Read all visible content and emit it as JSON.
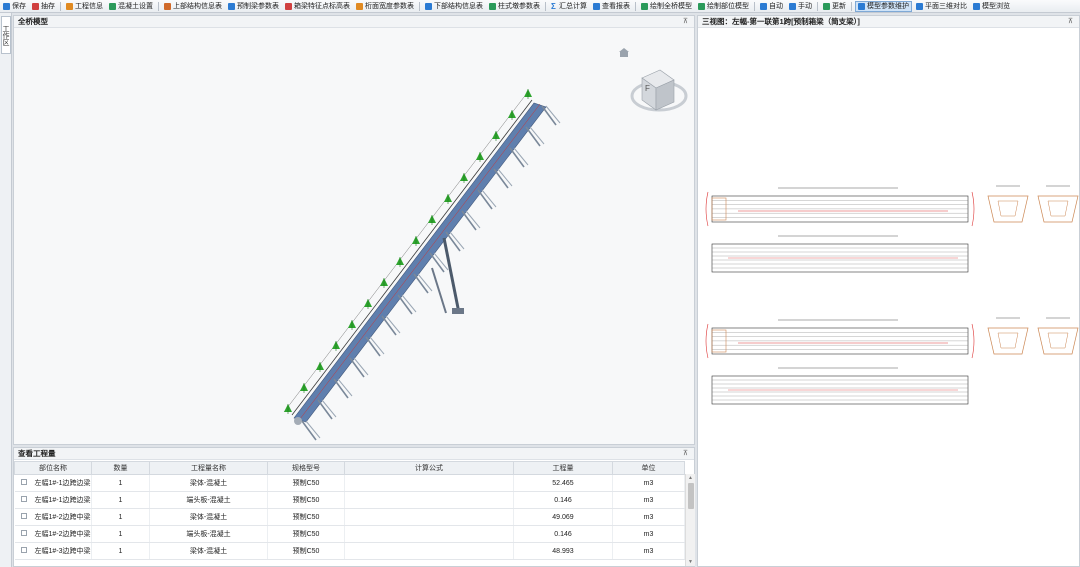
{
  "toolbar": {
    "items": [
      {
        "label": "保存",
        "color": "#2b7bd3"
      },
      {
        "label": "抽存",
        "color": "#d04040"
      },
      {
        "label": "工程信息",
        "color": "#e08a22"
      },
      {
        "label": "混凝土设置",
        "color": "#2a9a5a"
      },
      {
        "label": "上部结构信息表",
        "color": "#d06a2a"
      },
      {
        "label": "预制梁参数表",
        "color": "#2b7bd3"
      },
      {
        "label": "箱梁特征点标高表",
        "color": "#d04040"
      },
      {
        "label": "桁面宽度参数表",
        "color": "#e08a22"
      },
      {
        "label": "下部结构信息表",
        "color": "#2b7bd3"
      },
      {
        "label": "柱式墩参数表",
        "color": "#2a9a5a"
      },
      {
        "label": "汇总计算",
        "glyph": "Σ",
        "color": "#2b7bd3"
      },
      {
        "label": "查看报表",
        "color": "#2b7bd3"
      },
      {
        "label": "绘制全桥模型",
        "color": "#2a9a5a"
      },
      {
        "label": "绘制部位模型",
        "color": "#2a9a5a"
      },
      {
        "label": "自动",
        "color": "#2b7bd3"
      },
      {
        "label": "手动",
        "color": "#2b7bd3"
      },
      {
        "label": "更新",
        "color": "#2a9a5a"
      },
      {
        "label": "模型参数维护",
        "color": "#2b7bd3",
        "active": true
      },
      {
        "label": "平面三维对比",
        "color": "#2b7bd3"
      },
      {
        "label": "模型浏览",
        "color": "#2b7bd3"
      }
    ]
  },
  "left_tab": {
    "label": "工作区"
  },
  "model_panel": {
    "title": "全桥模型",
    "pin": "⊼",
    "viewcube_face": "F"
  },
  "drawing_panel": {
    "title": "三视图：左幅-第一联第1跨[预制箱梁（简支梁）]",
    "pin": "⊼"
  },
  "quantity_panel": {
    "title": "查看工程量",
    "pin": "⊼",
    "columns": [
      "部位名称",
      "数量",
      "工程量名称",
      "规格型号",
      "计算公式",
      "工程量",
      "单位"
    ],
    "rows": [
      [
        "左幅1#-1边跨边梁",
        "1",
        "梁体-混凝土",
        "预制C50",
        "",
        "52.465",
        "m3"
      ],
      [
        "左幅1#-1边跨边梁",
        "1",
        "端头板-混凝土",
        "预制C50",
        "",
        "0.146",
        "m3"
      ],
      [
        "左幅1#-2边跨中梁",
        "1",
        "梁体-混凝土",
        "预制C50",
        "",
        "49.069",
        "m3"
      ],
      [
        "左幅1#-2边跨中梁",
        "1",
        "端头板-混凝土",
        "预制C50",
        "",
        "0.146",
        "m3"
      ],
      [
        "左幅1#-3边跨中梁",
        "1",
        "梁体-混凝土",
        "预制C50",
        "",
        "48.993",
        "m3"
      ]
    ]
  },
  "colors": {
    "accent": "#2b7bd3",
    "beam": "#5f7fae",
    "marker": "#2ea52e",
    "pier": "#7a8899"
  }
}
